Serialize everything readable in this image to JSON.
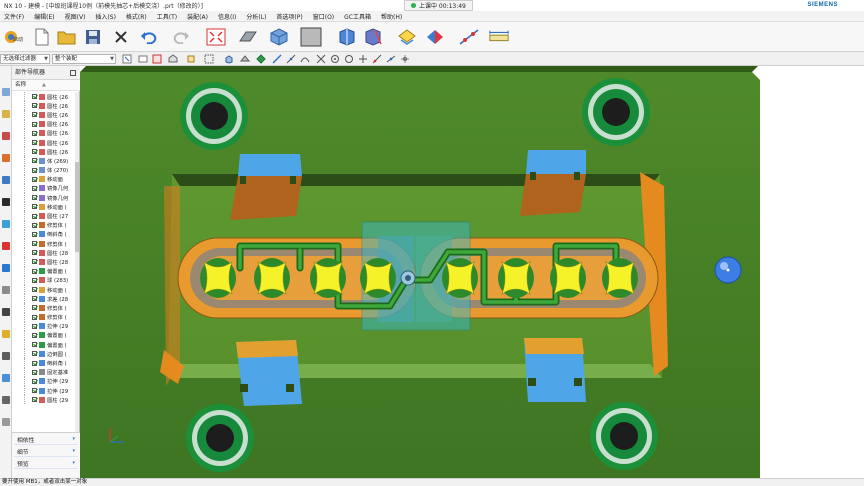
{
  "window": {
    "title": "NX 10 - 建模 - [中级班课程10例（前模先抽芯+后模交浇）.prt（修改的）]",
    "recording": "上课中 00:13:49",
    "brand": "SIEMENS"
  },
  "menu": [
    "文件(F)",
    "编辑(E)",
    "视图(V)",
    "插入(S)",
    "格式(R)",
    "工具(T)",
    "装配(A)",
    "信息(I)",
    "分析(L)",
    "首选项(P)",
    "窗口(O)",
    "GC工具箱",
    "帮助(H)"
  ],
  "toolbar": {
    "start_label": "启动",
    "icons": [
      "start-icon",
      "new-file-icon",
      "open-folder-icon",
      "save-icon",
      "close-x-icon",
      "undo-icon",
      "redo-icon",
      "fit-view-icon",
      "shaded-surface-icon",
      "shaded-cube-icon",
      "background-color-icon",
      "view-orient-icon",
      "section-view-icon",
      "layer-icon",
      "measure-icon",
      "snap-icon",
      "ruler-icon"
    ]
  },
  "selection_bar": {
    "filter_value": "无选择过滤器",
    "scope_value": "整个装配"
  },
  "part_navigator": {
    "title": "部件导航器",
    "column_name": "名称",
    "items": [
      "圆柱 (26",
      "圆柱 (26",
      "圆柱 (26",
      "圆柱 (26",
      "圆柱 (26",
      "圆柱 (26",
      "圆柱 (26",
      "体 (269)",
      "体 (270)",
      "移动面",
      "镜像几何",
      "镜像几何",
      "移动面 (",
      "圆柱 (27",
      "修剪体 (",
      "倒斜角 (",
      "修剪体 (",
      "圆柱 (28",
      "圆柱 (28",
      "偏置面 (",
      "球 (283)",
      "移动面 (",
      "求差 (28",
      "修剪体 (",
      "修剪体 (",
      "拉伸 (29",
      "偏置面 (",
      "偏置面 (",
      "边倒圆 (",
      "倒斜角 (",
      "固定基准",
      "拉伸 (29",
      "拉伸 (29",
      "圆柱 (29"
    ],
    "sections": [
      "相依性",
      "细节",
      "预览"
    ]
  },
  "status": {
    "message": "要开使用 MB1，或者双击某一对象"
  }
}
